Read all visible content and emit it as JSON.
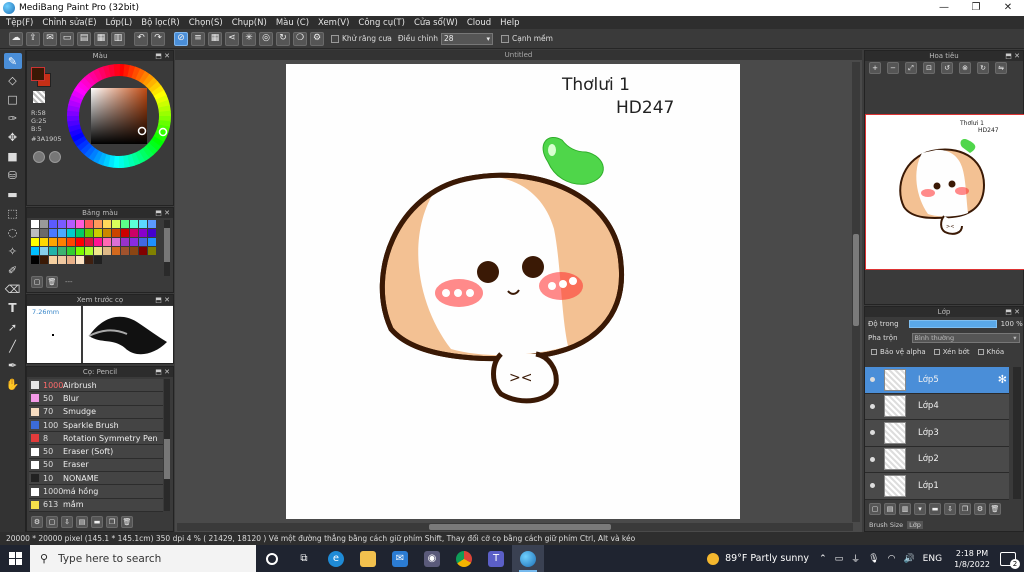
{
  "window": {
    "title": "MediBang Paint Pro (32bit)",
    "minimize": "—",
    "maximize": "❐",
    "close": "✕"
  },
  "menu": [
    "Tệp(F)",
    "Chỉnh sửa(E)",
    "Lớp(L)",
    "Bộ lọc(R)",
    "Chọn(S)",
    "Chụp(N)",
    "Màu (C)",
    "Xem(V)",
    "Công cụ(T)",
    "Cửa sổ(W)",
    "Cloud",
    "Help"
  ],
  "toolbar": {
    "antialias_label": "Khử răng cưa",
    "adjust_label": "Điều chỉnh",
    "adjust_value": "28",
    "snap_label": "Cạnh mềm"
  },
  "tools": [
    "brush-icon",
    "eraser-icon",
    "rect-icon",
    "pen-icon",
    "move-icon",
    "fill-rect-icon",
    "bucket-icon",
    "gradient-icon",
    "select-icon",
    "lasso-icon",
    "magic-wand-icon",
    "select-pen-icon",
    "select-eraser-icon",
    "text-icon",
    "operation-icon",
    "divide-icon",
    "eyedropper-icon",
    "hand-icon"
  ],
  "color_panel": {
    "title": "Màu",
    "r": "R:58",
    "g": "G:25",
    "b": "B:5",
    "hex": "#3A1905",
    "fg_color": "#3A1905",
    "bg_color": "#C62F16"
  },
  "palette_panel": {
    "title": "Bảng màu",
    "colors": [
      "#ffffff",
      "#9a9a9a",
      "#5b5bff",
      "#7a5bff",
      "#b35bff",
      "#ff5bd8",
      "#ff5b5b",
      "#ff9a5b",
      "#ffd85b",
      "#d8ff5b",
      "#5bff8a",
      "#5bffd8",
      "#5bd8ff",
      "#5b9aff",
      "#bdbdbd",
      "#6a6a6a",
      "#4a7aff",
      "#4aaaff",
      "#00cccc",
      "#00cc66",
      "#66cc00",
      "#cccc00",
      "#cc8800",
      "#cc4400",
      "#cc0000",
      "#cc0066",
      "#8800cc",
      "#4400cc",
      "#ffff00",
      "#ffd700",
      "#ffa500",
      "#ff7f00",
      "#ff4500",
      "#ff0000",
      "#dc143c",
      "#ff1493",
      "#ff69b4",
      "#da70d6",
      "#9932cc",
      "#8a2be2",
      "#4169e1",
      "#1e90ff",
      "#00bfff",
      "#87ceeb",
      "#20b2aa",
      "#3cb371",
      "#32cd32",
      "#7cfc00",
      "#adff2f",
      "#f0e68c",
      "#deb887",
      "#d2691e",
      "#a0522d",
      "#8b4513",
      "#800000",
      "#808000",
      "#000000",
      "#3a1905",
      "#f5d0a0",
      "#f0c8a0",
      "#e8b088",
      "#ffe4c4",
      "#402010",
      "#202020"
    ],
    "footer": "---"
  },
  "preview_panel": {
    "title": "Xem trước cọ",
    "size": "7.26mm"
  },
  "brush_panel": {
    "title": "Cọ: Pencil",
    "brushes": [
      {
        "size": "1000",
        "name": "Airbrush",
        "color": "#e6e6e6",
        "size_color": "#ff6b6b"
      },
      {
        "size": "50",
        "name": "Blur",
        "color": "#f49ae8",
        "size_color": "#dddddd"
      },
      {
        "size": "70",
        "name": "Smudge",
        "color": "#f6dcc0",
        "size_color": "#dddddd"
      },
      {
        "size": "100",
        "name": "Sparkle Brush",
        "color": "#3b6bd8",
        "size_color": "#dddddd"
      },
      {
        "size": "8",
        "name": "Rotation Symmetry Pen",
        "color": "#e23b3b",
        "size_color": "#dddddd"
      },
      {
        "size": "50",
        "name": "Eraser (Soft)",
        "color": "#ffffff",
        "size_color": "#dddddd"
      },
      {
        "size": "50",
        "name": "Eraser",
        "color": "#ffffff",
        "size_color": "#dddddd"
      },
      {
        "size": "10",
        "name": "NONAME",
        "color": "#222222",
        "size_color": "#dddddd"
      },
      {
        "size": "1000",
        "name": "má hồng",
        "color": "#ffffff",
        "size_color": "#dddddd"
      },
      {
        "size": "613",
        "name": "mắm",
        "color": "#f5e04a",
        "size_color": "#dddddd"
      }
    ]
  },
  "canvas": {
    "doc_title": "Untitled",
    "text_line1": "Thơlưi 1",
    "text_line2": "HD247"
  },
  "navigator_panel": {
    "title": "Hoa tiêu",
    "thumb_text1": "Thơlưi 1",
    "thumb_text2": "HD247"
  },
  "layer_panel": {
    "title": "Lớp",
    "opacity_label": "Độ trong",
    "opacity_value": "100 %",
    "opacity": 1.0,
    "blend_label": "Pha trộn",
    "blend_value": "Bình thường",
    "protect_alpha": "Bảo vệ alpha",
    "clipping": "Xén bớt",
    "lock": "Khóa",
    "layers": [
      "Lớp5",
      "Lớp4",
      "Lớp3",
      "Lớp2",
      "Lớp1"
    ],
    "tabs": [
      "Brush Size",
      "Lớp"
    ]
  },
  "status": {
    "text": "20000 * 20000 pixel   (145.1 * 145.1cm)  350 dpi   4 %   ( 21429, 18120 )   Vẽ một đường thẳng bằng cách giữ phím Shift, Thay đổi cỡ cọ bằng cách giữ phím Ctrl, Alt và kéo"
  },
  "taskbar": {
    "search_placeholder": "Type here to search",
    "weather": "89°F  Partly sunny",
    "lang": "ENG",
    "time": "2:18 PM",
    "date": "1/8/2022",
    "notif_count": "2"
  }
}
